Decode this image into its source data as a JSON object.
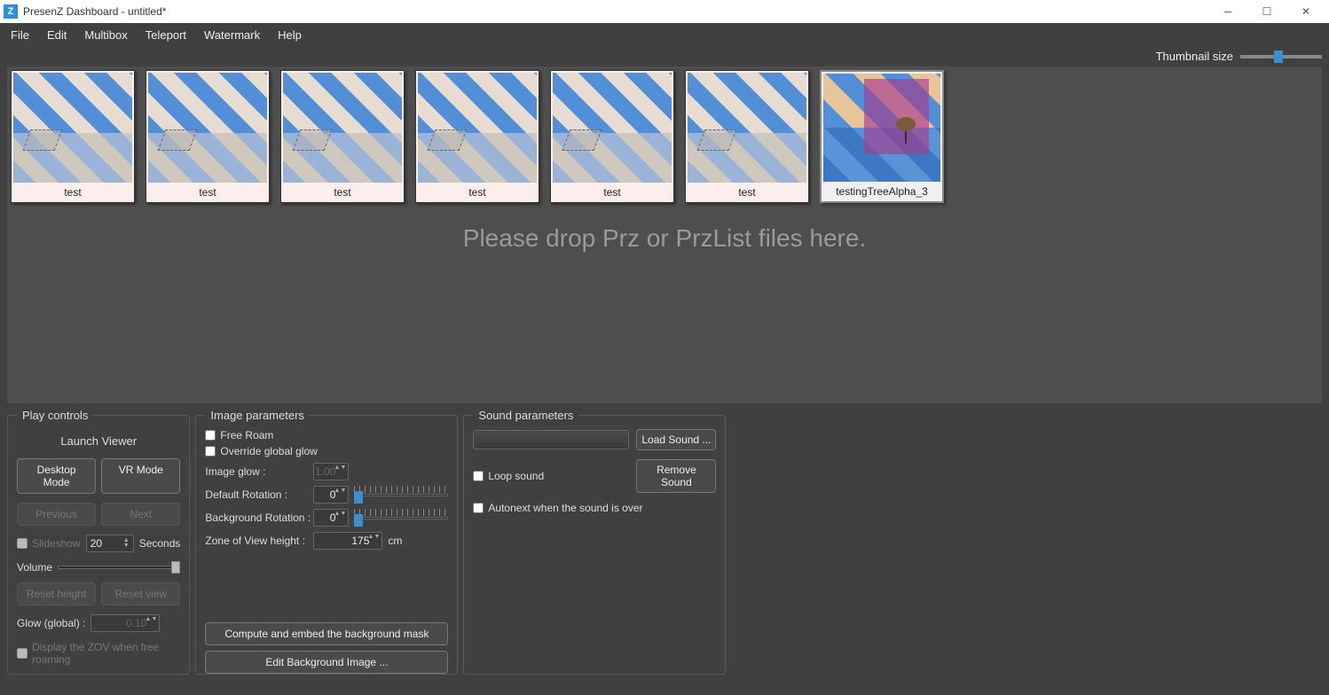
{
  "window": {
    "title": "PresenZ Dashboard - untitled*"
  },
  "menu": [
    "File",
    "Edit",
    "Multibox",
    "Teleport",
    "Watermark",
    "Help"
  ],
  "thumbnail_size_label": "Thumbnail size",
  "drop_hint": "Please drop Prz or PrzList files here.",
  "thumbs": [
    {
      "label": "test",
      "selected": false
    },
    {
      "label": "test",
      "selected": false
    },
    {
      "label": "test",
      "selected": false
    },
    {
      "label": "test",
      "selected": false
    },
    {
      "label": "test",
      "selected": false
    },
    {
      "label": "test",
      "selected": false
    },
    {
      "label": "testingTreeAlpha_3",
      "selected": true
    }
  ],
  "play": {
    "legend": "Play controls",
    "launch": "Launch Viewer",
    "desktop": "Desktop Mode",
    "vr": "VR Mode",
    "previous": "Previous",
    "next": "Next",
    "slideshow": "Slideshow",
    "slideshow_val": "20",
    "seconds": "Seconds",
    "volume": "Volume",
    "reset_height": "Reset height",
    "reset_view": "Reset view",
    "glow_global": "Glow (global) :",
    "glow_global_val": "0.10",
    "display_zov": "Display the ZOV when free roaming"
  },
  "image": {
    "legend": "Image parameters",
    "free_roam": "Free Roam",
    "override_glow": "Override global glow",
    "image_glow": "Image glow :",
    "image_glow_val": "1.00",
    "default_rot": "Default Rotation :",
    "default_rot_val": "0",
    "bg_rot": "Background Rotation :",
    "bg_rot_val": "0",
    "zov_height": "Zone of View height :",
    "zov_height_val": "175",
    "cm": "cm",
    "compute_mask": "Compute and embed the background mask",
    "edit_bg": "Edit Background Image ..."
  },
  "sound": {
    "legend": "Sound parameters",
    "load": "Load Sound ...",
    "remove": "Remove Sound",
    "loop": "Loop sound",
    "autonext": "Autonext when the sound is over"
  }
}
